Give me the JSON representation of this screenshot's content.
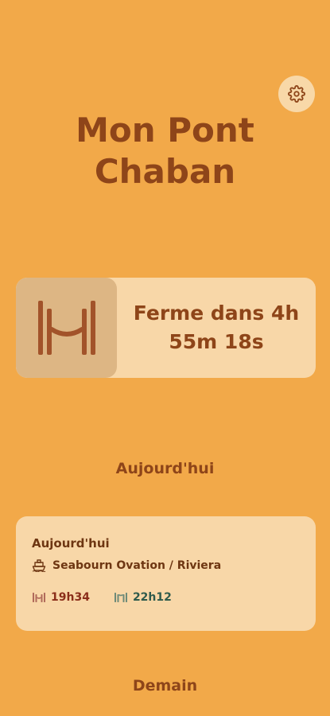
{
  "header": {
    "title_line1": "Mon Pont",
    "title_line2": "Chaban",
    "settings_icon": "gear-icon"
  },
  "status": {
    "icon": "bridge-icon",
    "text_line1": "Ferme dans 4h",
    "text_line2": "55m 18s"
  },
  "sections": {
    "today_heading": "Aujourd'hui",
    "tomorrow_heading": "Demain"
  },
  "today_card": {
    "title": "Aujourd'hui",
    "ship_icon": "ship-icon",
    "ship_name": "Seabourn Ovation / Riviera",
    "closing_time": "19h34",
    "opening_time": "22h12",
    "colors": {
      "closing": "#8B2E1A",
      "opening": "#2E5A4C"
    }
  },
  "colors": {
    "background": "#F2A949",
    "card": "#F8D7A8",
    "accent_text": "#8E4519"
  }
}
